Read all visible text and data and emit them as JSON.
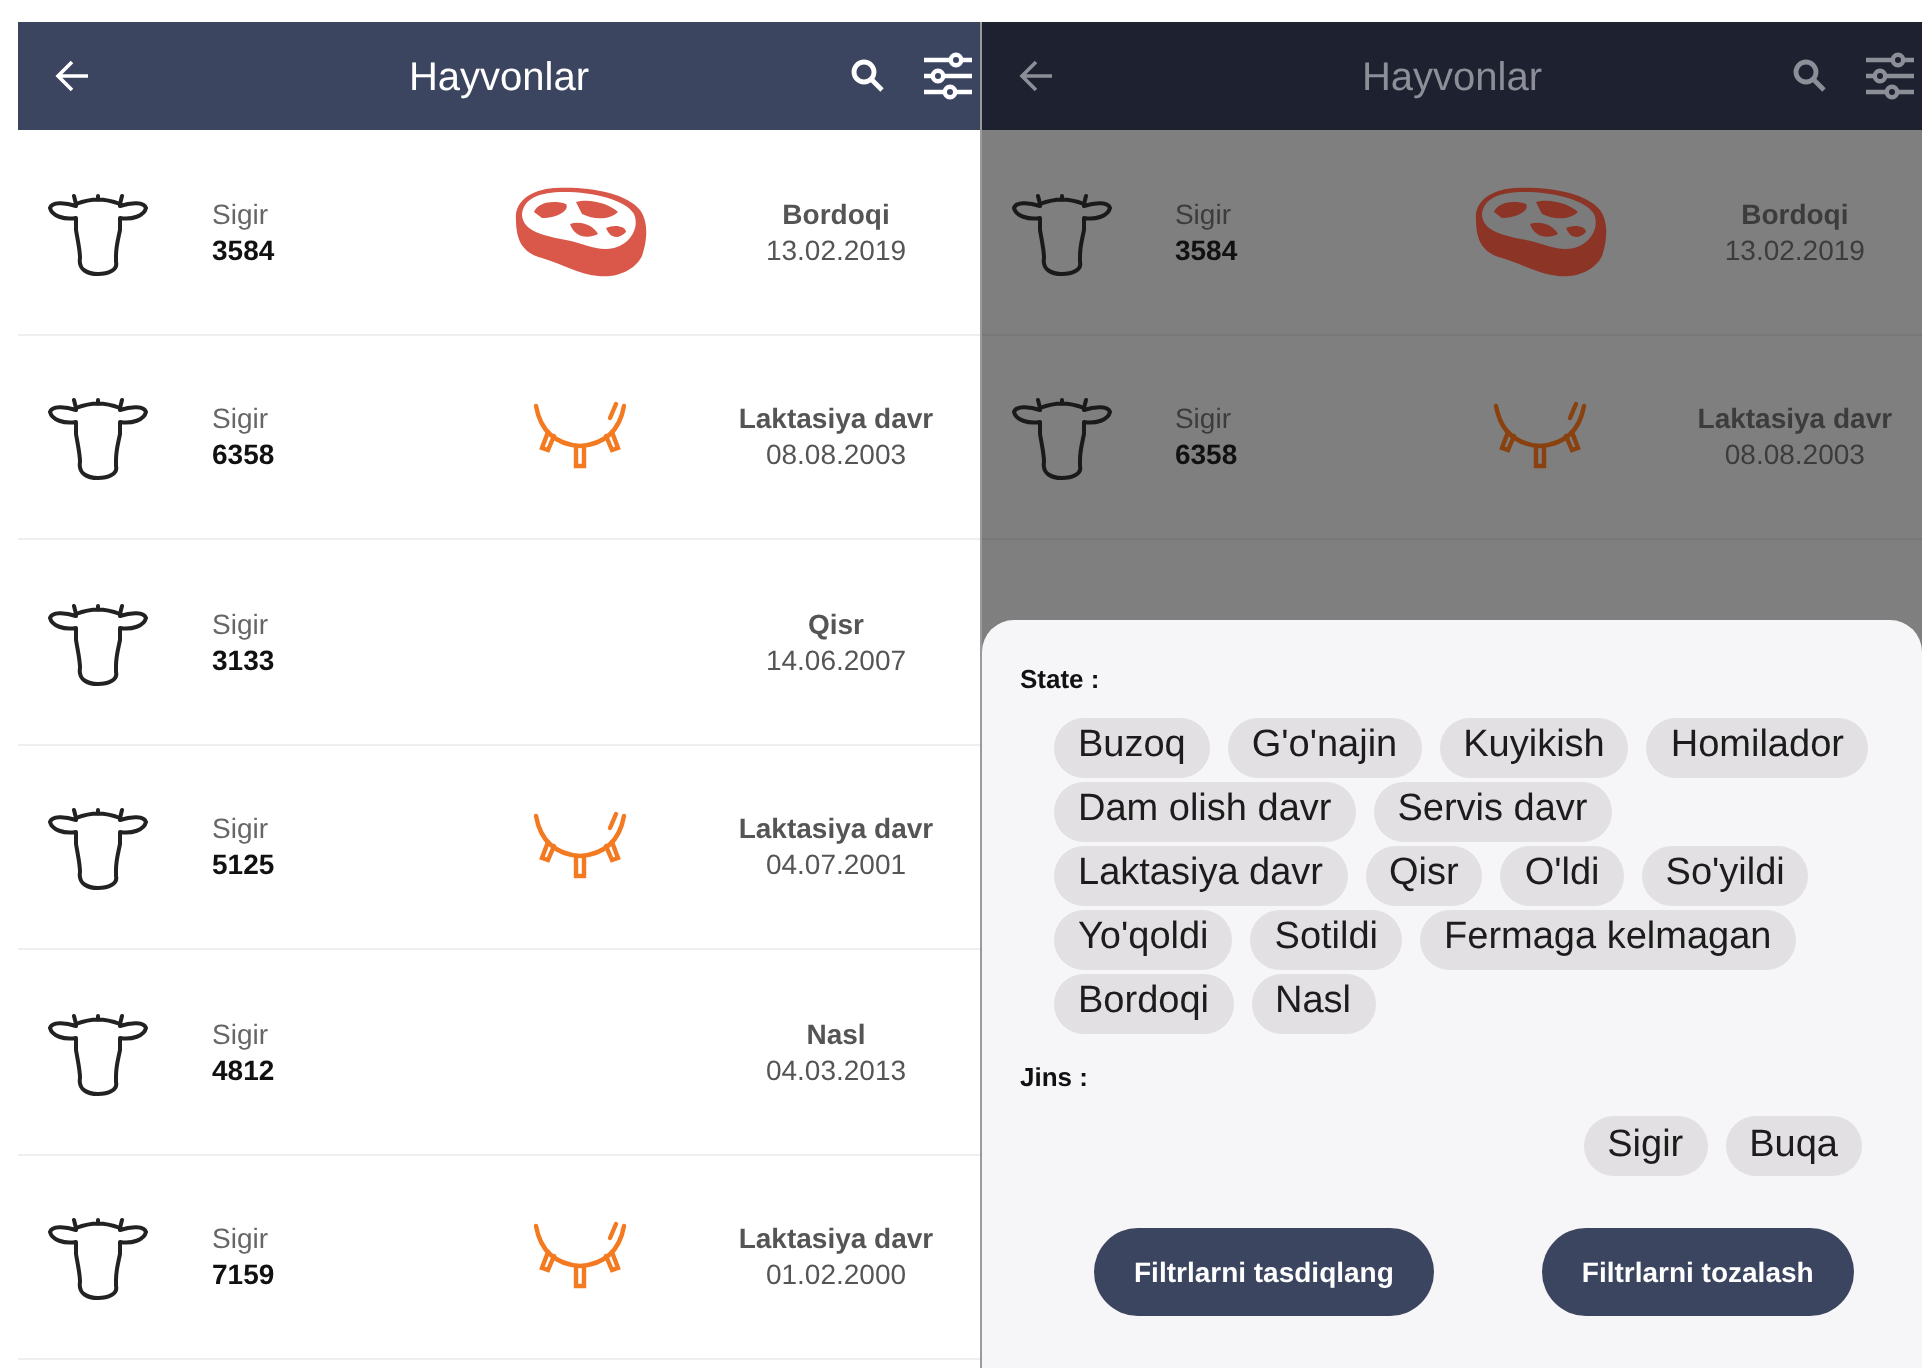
{
  "screen": {
    "title": "Hayvonlar",
    "rows": [
      {
        "type": "Sigir",
        "number": "3584",
        "kind": "meat",
        "status": "Bordoqi",
        "date": "13.02.2019"
      },
      {
        "type": "Sigir",
        "number": "6358",
        "kind": "udder",
        "status": "Laktasiya davr",
        "date": "08.08.2003"
      },
      {
        "type": "Sigir",
        "number": "3133",
        "status": "Qisr",
        "date": "14.06.2007"
      },
      {
        "type": "Sigir",
        "number": "5125",
        "kind": "udder",
        "status": "Laktasiya davr",
        "date": "04.07.2001"
      },
      {
        "type": "Sigir",
        "number": "4812",
        "status": "Nasl",
        "date": "04.03.2013"
      },
      {
        "type": "Sigir",
        "number": "7159",
        "kind": "udder",
        "status": "Laktasiya davr",
        "date": "01.02.2000"
      }
    ]
  },
  "dimmed_screen": {
    "title": "Hayvonlar",
    "rows": [
      {
        "type": "Sigir",
        "number": "3584",
        "kind": "meat",
        "status": "Bordoqi",
        "date": "13.02.2019"
      },
      {
        "type": "Sigir",
        "number": "6358",
        "kind": "udder",
        "status": "Laktasiya davr",
        "date": "08.08.2003"
      }
    ]
  },
  "filter_sheet": {
    "state_label": "State :",
    "states": [
      "Buzoq",
      "G'o'najin",
      "Kuyikish",
      "Homilador",
      "Dam olish davr",
      "Servis davr",
      "Laktasiya davr",
      "Qisr",
      "O'ldi",
      "So'yildi",
      "Yo'qoldi",
      "Sotildi",
      "Fermaga kelmagan",
      "Bordoqi",
      "Nasl"
    ],
    "gender_label": "Jins :",
    "genders": [
      "Sigir",
      "Buqa"
    ],
    "buttons": [
      "Filtrlarni tasdiqlang",
      "Filtrlarni tozalash"
    ]
  }
}
